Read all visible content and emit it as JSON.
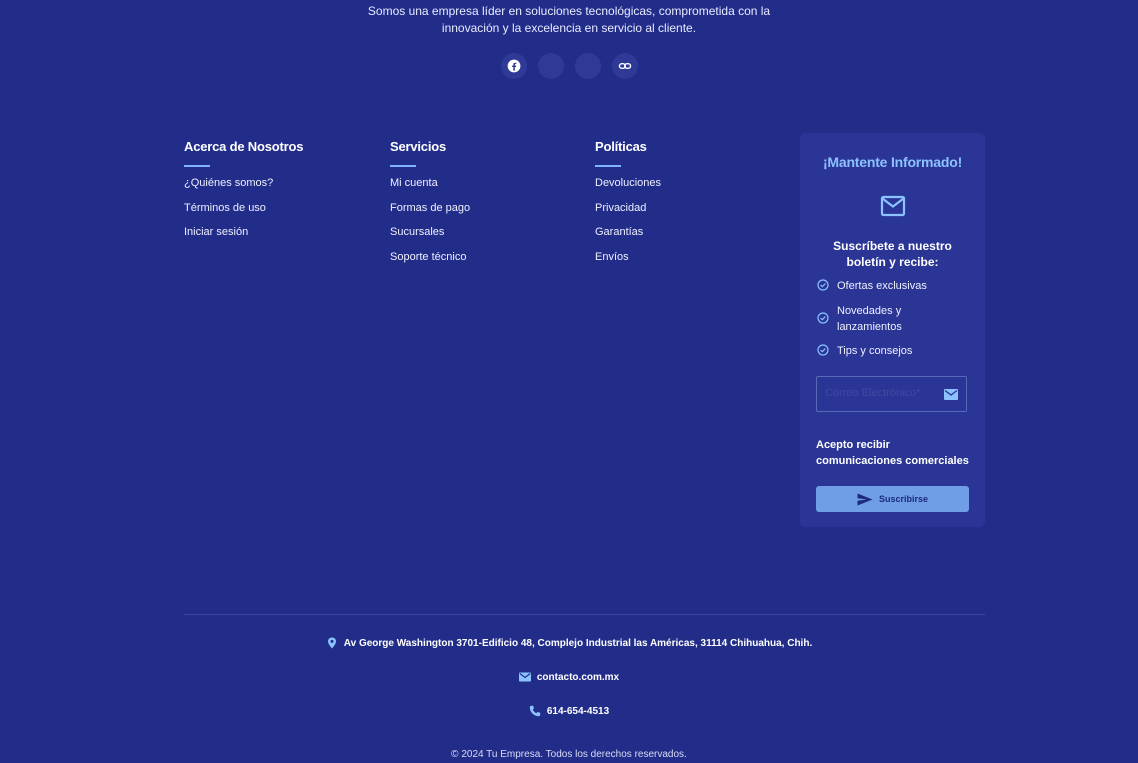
{
  "intro": {
    "line1": "Somos una empresa líder en soluciones tecnológicas, comprometida con la",
    "line2": "innovación y la excelencia en servicio al cliente."
  },
  "social": {
    "icons": [
      "facebook-icon",
      "",
      "",
      "link-icon"
    ]
  },
  "columns": [
    {
      "title": "Acerca de Nosotros",
      "links": [
        "¿Quiénes somos?",
        "Términos de uso",
        "Iniciar sesión"
      ]
    },
    {
      "title": "Servicios",
      "links": [
        "Mi cuenta",
        "Formas de pago",
        "Sucursales",
        "Soporte técnico"
      ]
    },
    {
      "title": "Políticas",
      "links": [
        "Devoluciones",
        "Privacidad",
        "Garantías",
        "Envíos"
      ]
    }
  ],
  "newsletter": {
    "title": "¡Mantente Informado!",
    "subtitle": "Suscríbete a nuestro boletín y recibe:",
    "benefits": [
      "Ofertas exclusivas",
      "Novedades y lanzamientos",
      "Tips y consejos"
    ],
    "email_placeholder": "Correo Electrónico*",
    "consent": "Acepto recibir comunicaciones comerciales",
    "subscribe_label": "Suscribirse"
  },
  "contact": {
    "address": "Av George Washington 3701-Edificio 48, Complejo Industrial las Américas, 31114 Chihuahua, Chih.",
    "email": "contacto.com.mx",
    "phone": "614-654-4513"
  },
  "copyright": "© 2024 Tu Empresa. Todos los derechos reservados.",
  "colors": {
    "background": "#222d8a",
    "card": "#2a3596",
    "accent": "#8cc2ff",
    "button": "#6f9de6"
  }
}
